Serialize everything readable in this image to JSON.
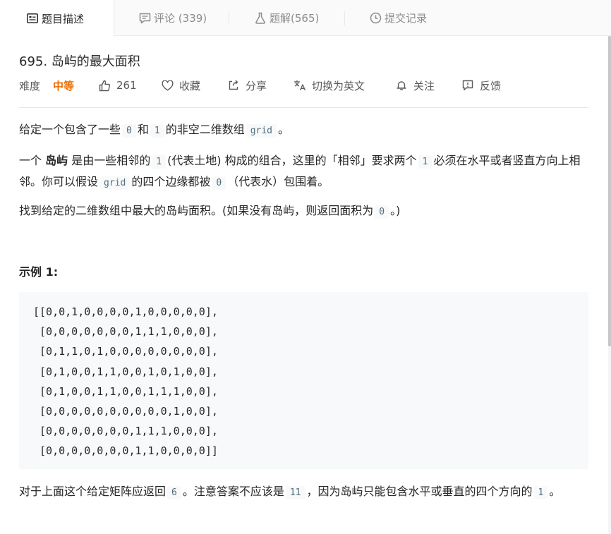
{
  "tabs": [
    {
      "label": "题目描述",
      "icon": "description-icon"
    },
    {
      "label": "评论 (339)",
      "icon": "comment-icon"
    },
    {
      "label": "题解(565)",
      "icon": "flask-icon"
    },
    {
      "label": "提交记录",
      "icon": "clock-icon"
    }
  ],
  "problem": {
    "title": "695. 岛屿的最大面积",
    "difficulty_label": "难度",
    "difficulty": "中等",
    "likes": "261",
    "favorite_label": "收藏",
    "share_label": "分享",
    "translate_label": "切换为英文",
    "follow_label": "关注",
    "feedback_label": "反馈"
  },
  "description": {
    "p1": {
      "a": "给定一个包含了一些",
      "c1": "0",
      "b": "和",
      "c2": "1",
      "c": "的非空二维数组",
      "c3": "grid",
      "d": "。"
    },
    "p2": {
      "a": "一个",
      "bold": "岛屿",
      "b": "是由一些相邻的",
      "c1": "1",
      "c": "(代表土地) 构成的组合，这里的「相邻」要求两个",
      "c2": "1",
      "d": "必须在水平或者竖直方向上相邻。你可以假设",
      "c3": "grid",
      "e": "的四个边缘都被",
      "c4": "0",
      "f": "（代表水）包围着。"
    },
    "p3": {
      "a": "找到给定的二维数组中最大的岛屿面积。(如果没有岛屿，则返回面积为",
      "c1": "0",
      "b": "。)"
    },
    "example_title": "示例 1:",
    "p4": {
      "a": "对于上面这个给定矩阵应返回",
      "c1": "6",
      "b": "。注意答案不应该是",
      "c2": "11",
      "c": "，因为岛屿只能包含水平或垂直的四个方向的",
      "c3": "1",
      "d": "。"
    }
  },
  "code_lines": [
    "[[0,0,1,0,0,0,0,1,0,0,0,0,0],",
    " [0,0,0,0,0,0,0,1,1,1,0,0,0],",
    " [0,1,1,0,1,0,0,0,0,0,0,0,0],",
    " [0,1,0,0,1,1,0,0,1,0,1,0,0],",
    " [0,1,0,0,1,1,0,0,1,1,1,0,0],",
    " [0,0,0,0,0,0,0,0,0,0,1,0,0],",
    " [0,0,0,0,0,0,0,1,1,1,0,0,0],",
    " [0,0,0,0,0,0,0,1,1,0,0,0,0]]"
  ],
  "colors": {
    "difficulty": "#ef6c00",
    "code_bg": "#f7f9fa"
  }
}
